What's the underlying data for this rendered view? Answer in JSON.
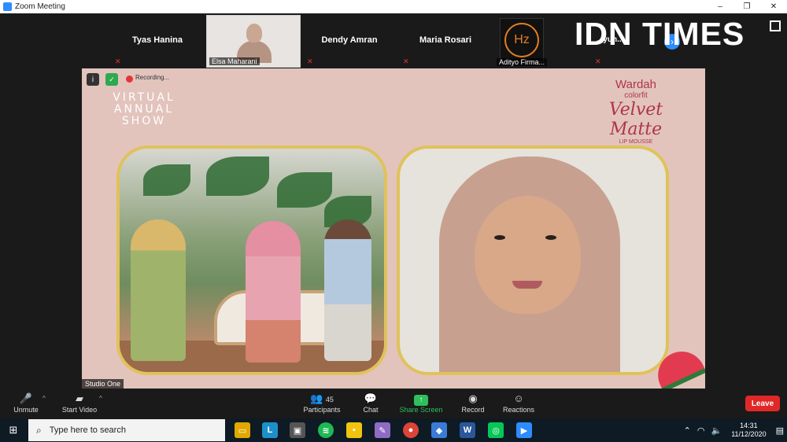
{
  "window": {
    "title": "Zoom Meeting",
    "minimize": "–",
    "restore": "❐",
    "close": "✕"
  },
  "participants": [
    {
      "name": "Tyas Hanina"
    },
    {
      "name": "Elsa Maharani"
    },
    {
      "name": "Dendy Amran"
    },
    {
      "name": "Maria Rosari"
    },
    {
      "name": "Adityo Firma..."
    },
    {
      "name": "...yun..."
    }
  ],
  "logo_hz": "Hz",
  "watermark": "IDN TIMES",
  "share": {
    "recording_label": "Recording...",
    "event_title": "VIRTUAL ANNUAL SHOW",
    "brand_name": "Wardah",
    "brand_sub": "colorfit",
    "product": "Velvet Matte",
    "product_sub": "LIP MOUSSE",
    "studio_label": "Studio One"
  },
  "controls": {
    "unmute": "Unmute",
    "start_video": "Start Video",
    "participants": "Participants",
    "participants_count": "45",
    "chat": "Chat",
    "share_screen": "Share Screen",
    "record": "Record",
    "reactions": "Reactions",
    "leave": "Leave"
  },
  "taskbar": {
    "search_placeholder": "Type here to search",
    "time": "14:31",
    "date": "11/12/2020"
  },
  "colors": {
    "accent": "#2d8cff",
    "leave": "#e02828",
    "share_green": "#2fbf5d",
    "taskbar": "#0e1a24"
  }
}
